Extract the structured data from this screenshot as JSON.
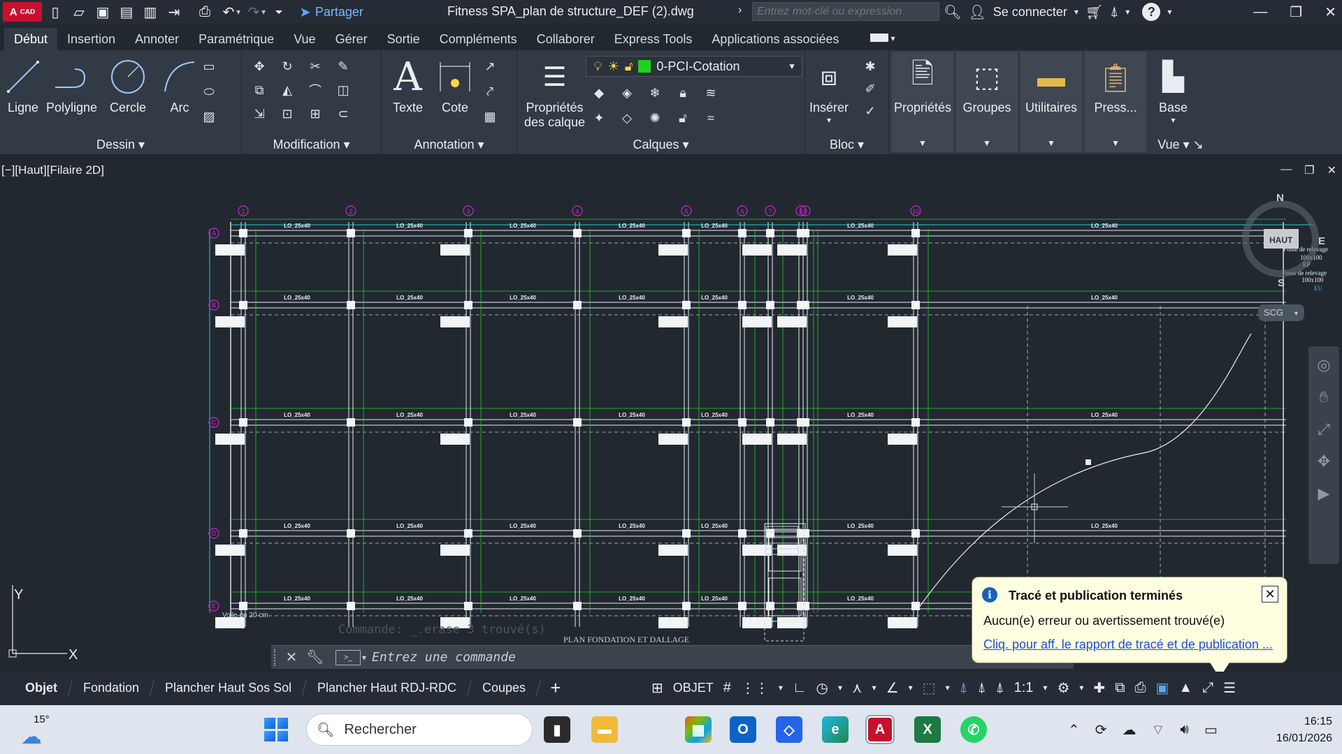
{
  "titlebar": {
    "logo_main": "A",
    "logo_sub": "CAD",
    "share_label": "Partager",
    "document_title": "Fitness SPA_plan de structure_DEF (2).dwg",
    "search_placeholder": "Entrez mot-clé ou expression",
    "signin_label": "Se connecter",
    "help_label": "?"
  },
  "ribbon_tabs": [
    "Début",
    "Insertion",
    "Annoter",
    "Paramétrique",
    "Vue",
    "Gérer",
    "Sortie",
    "Compléments",
    "Collaborer",
    "Express Tools",
    "Applications associées"
  ],
  "ribbon": {
    "draw_tools": [
      "Ligne",
      "Polyligne",
      "Cercle",
      "Arc"
    ],
    "panel_dessin": "Dessin",
    "panel_modification": "Modification",
    "texte": "Texte",
    "cote": "Cote",
    "panel_annotation": "Annotation",
    "layer_props_1": "Propriétés",
    "layer_props_2": "des calque",
    "current_layer": "0-PCI-Cotation",
    "panel_calques": "Calques",
    "inserer": "Insérer",
    "panel_bloc": "Bloc",
    "proprietes": "Propriétés",
    "groupes": "Groupes",
    "utilitaires": "Utilitaires",
    "presse": "Press...",
    "base": "Base",
    "panel_vue": "Vue"
  },
  "viewport": {
    "label": "[−][Haut][Filaire 2D]",
    "compass_n": "N",
    "compass_s": "S",
    "compass_e": "E",
    "compass_top": "HAUT",
    "ucs": "SCG",
    "axis_y": "Y",
    "axis_x": "X"
  },
  "drawing": {
    "grid_columns": [
      "1",
      "2",
      "3",
      "4",
      "5",
      "6",
      "7",
      "8",
      "9",
      "10"
    ],
    "grid_rows": [
      "A",
      "B",
      "C",
      "D",
      "E"
    ],
    "beam_label": "LO_25x40",
    "footer_title": "PLAN FONDATION ET DALLAGE",
    "note_fosse_1": "Fosse de relevage",
    "note_fosse_2": "100x100",
    "note_ep": "EP",
    "note_eu": "EU",
    "note_voile": "Voile de 20 cm"
  },
  "command": {
    "history": "Commande: _.erase 3 trouvé(s)",
    "placeholder": "Entrez une commande"
  },
  "notification": {
    "title": "Tracé et publication terminés",
    "body": "Aucun(e) erreur ou avertissement trouvé(e)",
    "link": "Cliq. pour aff. le rapport de tracé et de publication ..."
  },
  "layout_tabs": [
    "Objet",
    "Fondation",
    "Plancher Haut Sos Sol",
    "Plancher Haut RDJ-RDC",
    "Coupes"
  ],
  "statusbar": {
    "objet": "OBJET",
    "scale": "1:1"
  },
  "taskbar": {
    "temperature": "15°",
    "search_label": "Rechercher",
    "time": "16:15",
    "date": "16/01/2026"
  },
  "colors": {
    "canvas": "#212830",
    "ribbon": "#323a45",
    "grid_bubble": "#d020d0",
    "dimension_green": "#22d022",
    "dimension_cyan": "#22d0d0",
    "notification_bg": "#ffffe1"
  }
}
